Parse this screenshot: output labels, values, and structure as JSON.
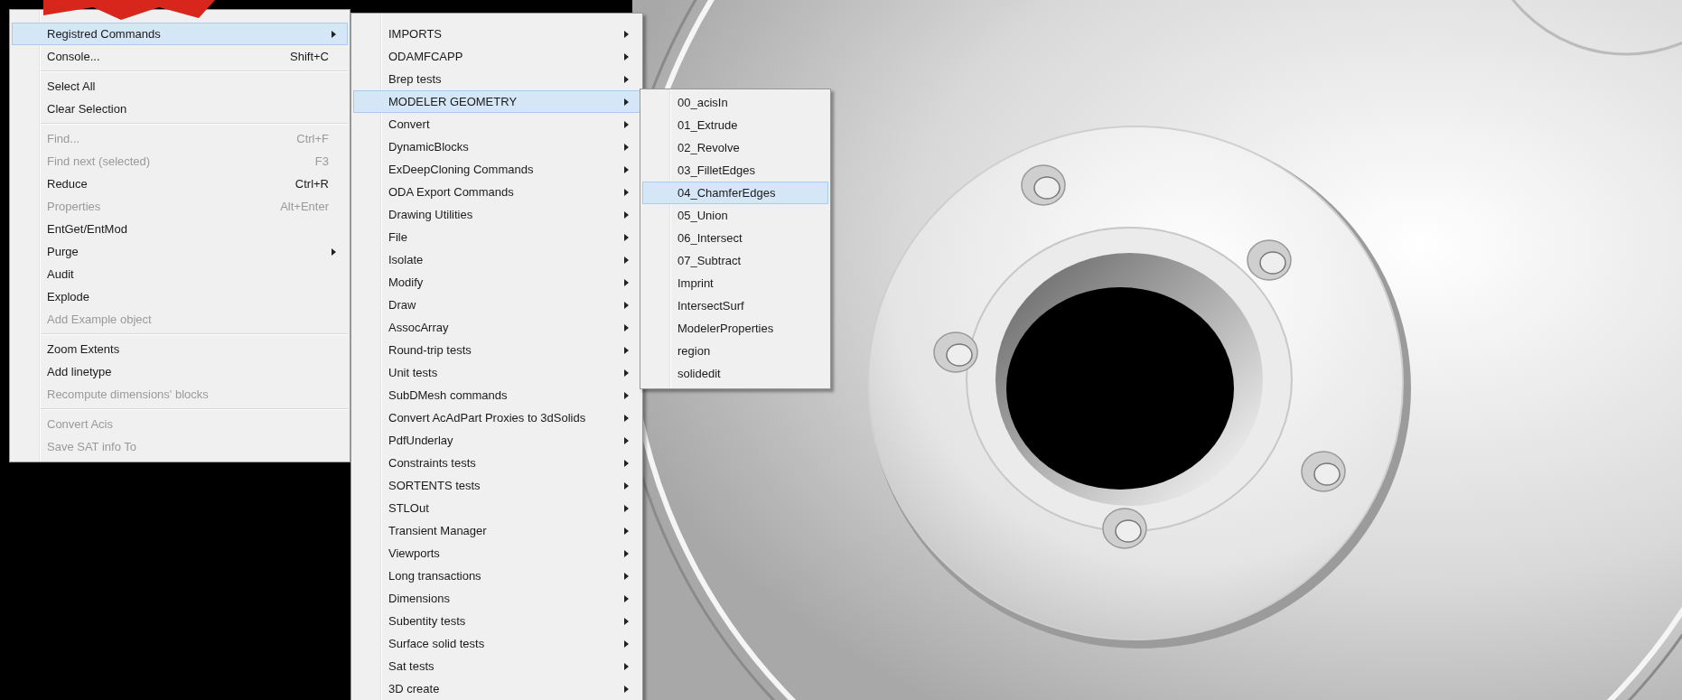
{
  "menus": [
    {
      "items": [
        {
          "kind": "item",
          "label": "Registred Commands",
          "selected": true,
          "disabled": false,
          "has_submenu": true
        },
        {
          "kind": "item",
          "label": "Console...",
          "shortcut": "Shift+C",
          "selected": false,
          "disabled": false,
          "has_submenu": false
        },
        {
          "kind": "separator"
        },
        {
          "kind": "item",
          "label": "Select All",
          "selected": false,
          "disabled": false,
          "has_submenu": false
        },
        {
          "kind": "item",
          "label": "Clear Selection",
          "selected": false,
          "disabled": false,
          "has_submenu": false
        },
        {
          "kind": "separator"
        },
        {
          "kind": "item",
          "label": "Find...",
          "shortcut": "Ctrl+F",
          "selected": false,
          "disabled": true,
          "has_submenu": false
        },
        {
          "kind": "item",
          "label": "Find next (selected)",
          "shortcut": "F3",
          "selected": false,
          "disabled": true,
          "has_submenu": false
        },
        {
          "kind": "item",
          "label": "Reduce",
          "shortcut": "Ctrl+R",
          "selected": false,
          "disabled": false,
          "has_submenu": false
        },
        {
          "kind": "item",
          "label": "Properties",
          "shortcut": "Alt+Enter",
          "selected": false,
          "disabled": true,
          "has_submenu": false
        },
        {
          "kind": "item",
          "label": "EntGet/EntMod",
          "selected": false,
          "disabled": false,
          "has_submenu": false
        },
        {
          "kind": "item",
          "label": "Purge",
          "selected": false,
          "disabled": false,
          "has_submenu": true
        },
        {
          "kind": "item",
          "label": "Audit",
          "selected": false,
          "disabled": false,
          "has_submenu": false
        },
        {
          "kind": "item",
          "label": "Explode",
          "selected": false,
          "disabled": false,
          "has_submenu": false
        },
        {
          "kind": "item",
          "label": "Add Example object",
          "selected": false,
          "disabled": true,
          "has_submenu": false
        },
        {
          "kind": "separator"
        },
        {
          "kind": "item",
          "label": "Zoom Extents",
          "selected": false,
          "disabled": false,
          "has_submenu": false
        },
        {
          "kind": "item",
          "label": "Add linetype",
          "selected": false,
          "disabled": false,
          "has_submenu": false
        },
        {
          "kind": "item",
          "label": "Recompute dimensions' blocks",
          "selected": false,
          "disabled": true,
          "has_submenu": false
        },
        {
          "kind": "separator"
        },
        {
          "kind": "item",
          "label": "Convert Acis",
          "selected": false,
          "disabled": true,
          "has_submenu": false
        },
        {
          "kind": "item",
          "label": "Save SAT info To",
          "selected": false,
          "disabled": true,
          "has_submenu": false
        }
      ]
    },
    {
      "items": [
        {
          "kind": "item",
          "label": "IMPORTS",
          "selected": false,
          "has_submenu": true
        },
        {
          "kind": "item",
          "label": "ODAMFCAPP",
          "selected": false,
          "has_submenu": true
        },
        {
          "kind": "item",
          "label": "Brep tests",
          "selected": false,
          "has_submenu": true
        },
        {
          "kind": "item",
          "label": "MODELER GEOMETRY",
          "selected": true,
          "has_submenu": true
        },
        {
          "kind": "item",
          "label": "Convert",
          "selected": false,
          "has_submenu": true
        },
        {
          "kind": "item",
          "label": "DynamicBlocks",
          "selected": false,
          "has_submenu": true
        },
        {
          "kind": "item",
          "label": "ExDeepCloning Commands",
          "selected": false,
          "has_submenu": true
        },
        {
          "kind": "item",
          "label": "ODA Export Commands",
          "selected": false,
          "has_submenu": true
        },
        {
          "kind": "item",
          "label": "Drawing Utilities",
          "selected": false,
          "has_submenu": true
        },
        {
          "kind": "item",
          "label": "File",
          "selected": false,
          "has_submenu": true
        },
        {
          "kind": "item",
          "label": "Isolate",
          "selected": false,
          "has_submenu": true
        },
        {
          "kind": "item",
          "label": "Modify",
          "selected": false,
          "has_submenu": true
        },
        {
          "kind": "item",
          "label": "Draw",
          "selected": false,
          "has_submenu": true
        },
        {
          "kind": "item",
          "label": "AssocArray",
          "selected": false,
          "has_submenu": true
        },
        {
          "kind": "item",
          "label": "Round-trip tests",
          "selected": false,
          "has_submenu": true
        },
        {
          "kind": "item",
          "label": "Unit tests",
          "selected": false,
          "has_submenu": true
        },
        {
          "kind": "item",
          "label": "SubDMesh commands",
          "selected": false,
          "has_submenu": true
        },
        {
          "kind": "item",
          "label": "Convert AcAdPart Proxies to 3dSolids",
          "selected": false,
          "has_submenu": true
        },
        {
          "kind": "item",
          "label": "PdfUnderlay",
          "selected": false,
          "has_submenu": true
        },
        {
          "kind": "item",
          "label": "Constraints tests",
          "selected": false,
          "has_submenu": true
        },
        {
          "kind": "item",
          "label": "SORTENTS tests",
          "selected": false,
          "has_submenu": true
        },
        {
          "kind": "item",
          "label": "STLOut",
          "selected": false,
          "has_submenu": true
        },
        {
          "kind": "item",
          "label": "Transient Manager",
          "selected": false,
          "has_submenu": true
        },
        {
          "kind": "item",
          "label": "Viewports",
          "selected": false,
          "has_submenu": true
        },
        {
          "kind": "item",
          "label": "Long transactions",
          "selected": false,
          "has_submenu": true
        },
        {
          "kind": "item",
          "label": "Dimensions",
          "selected": false,
          "has_submenu": true
        },
        {
          "kind": "item",
          "label": "Subentity tests",
          "selected": false,
          "has_submenu": true
        },
        {
          "kind": "item",
          "label": "Surface solid tests",
          "selected": false,
          "has_submenu": true
        },
        {
          "kind": "item",
          "label": "Sat tests",
          "selected": false,
          "has_submenu": true
        },
        {
          "kind": "item",
          "label": "3D create",
          "selected": false,
          "has_submenu": true
        }
      ]
    },
    {
      "items": [
        {
          "kind": "item",
          "label": "00_acisIn",
          "selected": false
        },
        {
          "kind": "item",
          "label": "01_Extrude",
          "selected": false
        },
        {
          "kind": "item",
          "label": "02_Revolve",
          "selected": false
        },
        {
          "kind": "item",
          "label": "03_FilletEdges",
          "selected": false
        },
        {
          "kind": "item",
          "label": "04_ChamferEdges",
          "selected": true
        },
        {
          "kind": "item",
          "label": "05_Union",
          "selected": false
        },
        {
          "kind": "item",
          "label": "06_Intersect",
          "selected": false
        },
        {
          "kind": "item",
          "label": "07_Subtract",
          "selected": false
        },
        {
          "kind": "item",
          "label": "Imprint",
          "selected": false
        },
        {
          "kind": "item",
          "label": "IntersectSurf",
          "selected": false
        },
        {
          "kind": "item",
          "label": "ModelerProperties",
          "selected": false
        },
        {
          "kind": "item",
          "label": "region",
          "selected": false
        },
        {
          "kind": "item",
          "label": "solidedit",
          "selected": false
        }
      ]
    }
  ]
}
